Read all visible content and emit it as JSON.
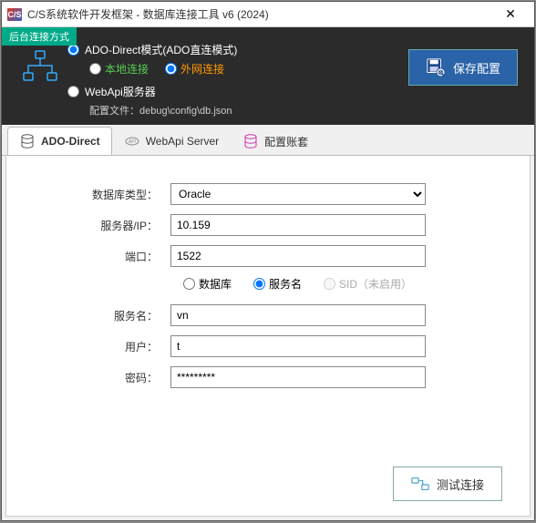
{
  "titlebar": {
    "icon_text": "C/S",
    "title": "C/S系统软件开发框架 - 数据库连接工具 v6 (2024)"
  },
  "top": {
    "badge": "后台连接方式",
    "ado_label": "ADO-Direct模式(ADO直连模式)",
    "local_label": "本地连接",
    "external_label": "外网连接",
    "webapi_label": "WebApi服务器",
    "config_prefix": "配置文件：",
    "config_path": "debug\\config\\db.json",
    "save_button": "保存配置"
  },
  "tabs": {
    "ado": "ADO-Direct",
    "webapi": "WebApi Server",
    "account": "配置账套"
  },
  "form": {
    "dbtype_label": "数据库类型：",
    "dbtype_value": "Oracle",
    "server_label": "服务器/IP：",
    "server_value": "10.159",
    "port_label": "端口：",
    "port_value": "1522",
    "radio_db": "数据库",
    "radio_service": "服务名",
    "radio_sid": "SID（未启用）",
    "service_label": "服务名：",
    "service_value": "vn",
    "user_label": "用户：",
    "user_value": "t",
    "password_label": "密码：",
    "password_value": "*********",
    "test_button": "测试连接"
  }
}
